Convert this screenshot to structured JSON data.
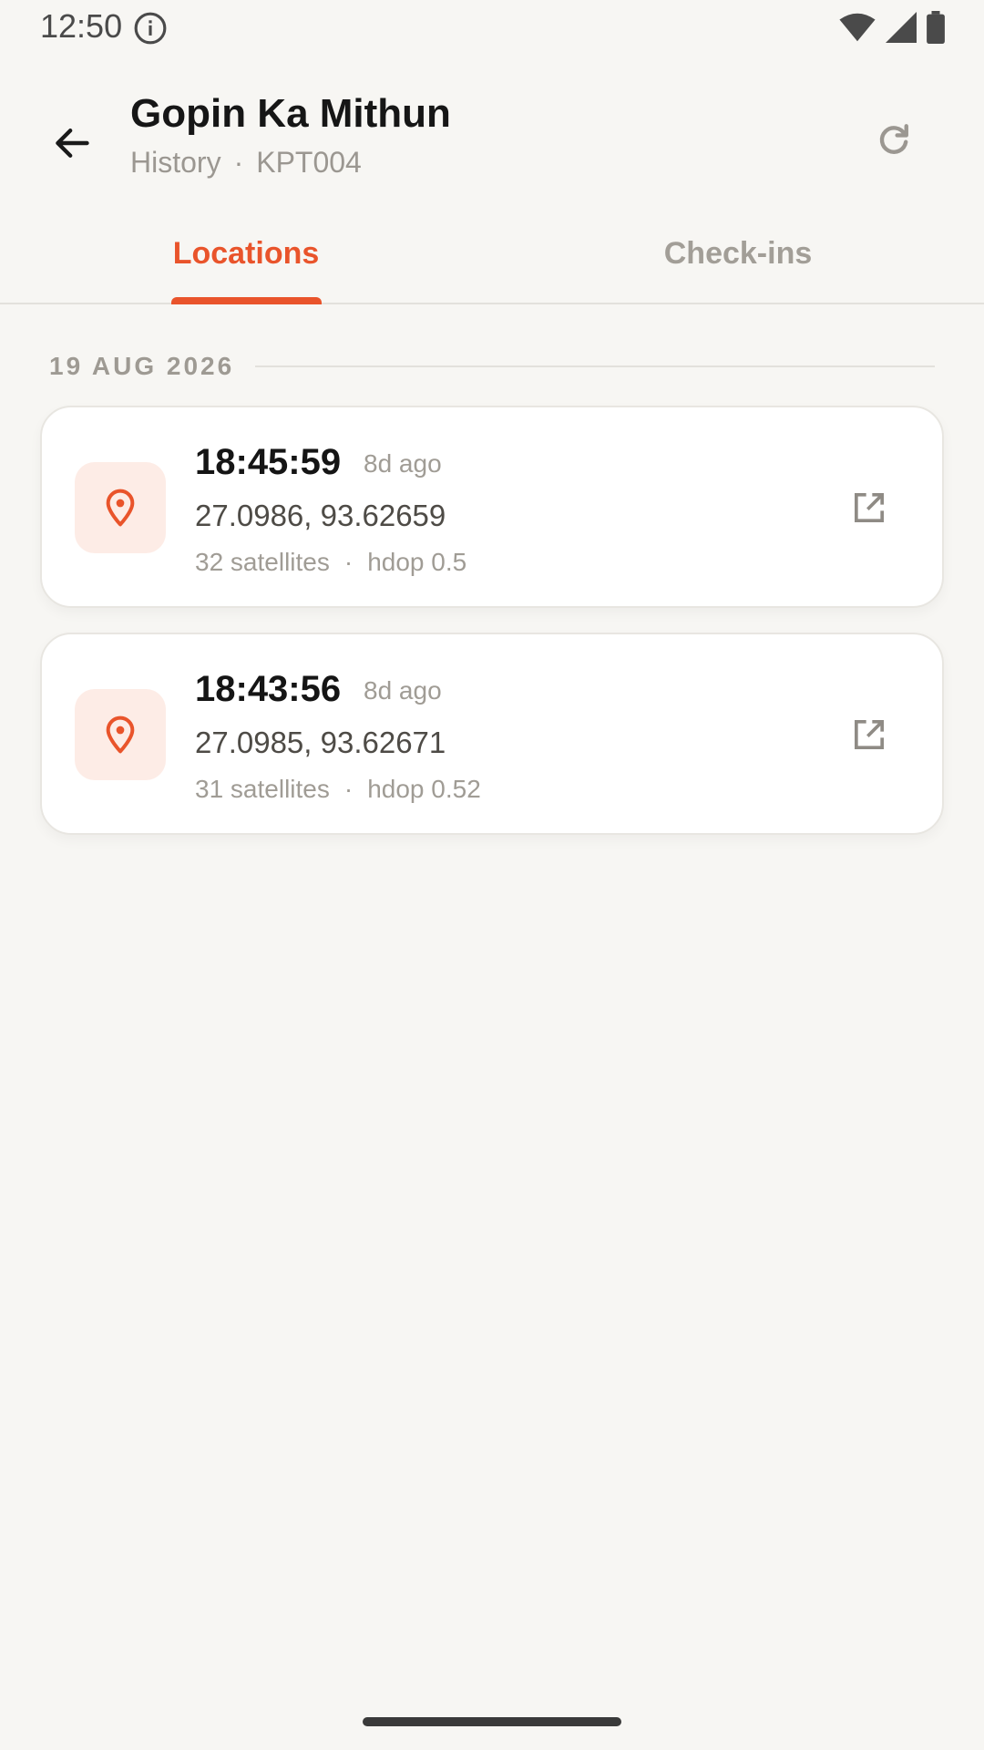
{
  "status_bar": {
    "time": "12:50",
    "icons": [
      "info-icon",
      "wifi-icon",
      "signal-icon",
      "battery-icon"
    ]
  },
  "header": {
    "title": "Gopin Ka Mithun",
    "subtitle_section": "History",
    "subtitle_separator": "·",
    "subtitle_id": "KPT004",
    "back_icon": "arrow-back-icon",
    "refresh_icon": "refresh-icon"
  },
  "tabs": [
    {
      "label": "Locations",
      "active": true
    },
    {
      "label": "Check-ins",
      "active": false
    }
  ],
  "section": {
    "date": "19 AUG 2026"
  },
  "locations": [
    {
      "time": "18:45:59",
      "ago": "8d ago",
      "coords": "27.0986, 93.62659",
      "satellites": "32 satellites",
      "separator": "·",
      "hdop": "hdop 0.5",
      "icon": "location-pin-icon",
      "action_icon": "open-external-icon"
    },
    {
      "time": "18:43:56",
      "ago": "8d ago",
      "coords": "27.0985, 93.62671",
      "satellites": "31 satellites",
      "separator": "·",
      "hdop": "hdop 0.52",
      "icon": "location-pin-icon",
      "action_icon": "open-external-icon"
    }
  ],
  "colors": {
    "accent": "#e9542b",
    "background": "#f7f6f3",
    "icon_bg": "#fdece6"
  }
}
